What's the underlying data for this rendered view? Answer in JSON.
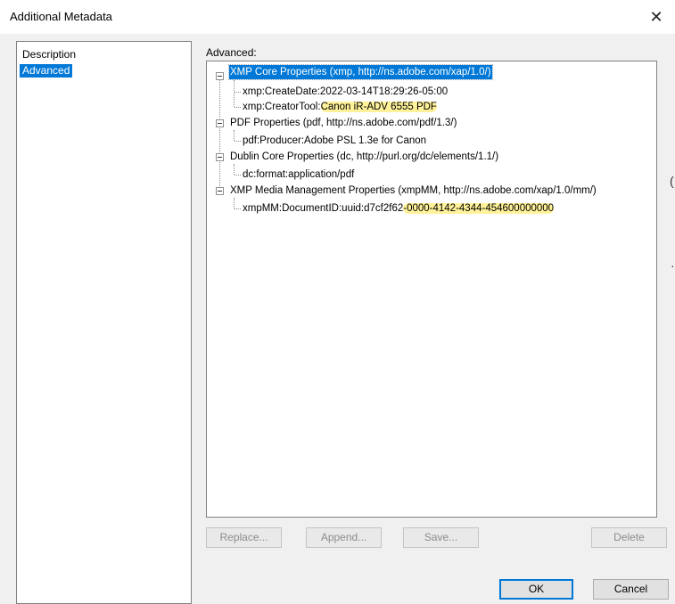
{
  "window": {
    "title": "Additional Metadata",
    "close_icon": "close-icon"
  },
  "sidebar": {
    "items": [
      {
        "label": "Description",
        "selected": false
      },
      {
        "label": "Advanced",
        "selected": true
      }
    ]
  },
  "main": {
    "label": "Advanced:",
    "tree": {
      "xmp": {
        "label": "XMP Core Properties (xmp, http://ns.adobe.com/xap/1.0/)",
        "create_date": "xmp:CreateDate:2022-03-14T18:29:26-05:00",
        "creator_tool_key": "xmp:CreatorTool:",
        "creator_tool_value": "Canon iR-ADV 6555  PDF"
      },
      "pdf": {
        "label": "PDF Properties (pdf, http://ns.adobe.com/pdf/1.3/)",
        "producer": "pdf:Producer:Adobe PSL 1.3e for Canon"
      },
      "dc": {
        "label": "Dublin Core Properties (dc, http://purl.org/dc/elements/1.1/)",
        "format": "dc:format:application/pdf"
      },
      "xmpmm": {
        "label": "XMP Media Management Properties (xmpMM, http://ns.adobe.com/xap/1.0/mm/)",
        "doc_id_key": "xmpMM:DocumentID:uuid:d7cf2f62",
        "doc_id_value": "-0000-4142-4344-454600000000"
      }
    }
  },
  "buttons": {
    "replace": "Replace...",
    "append": "Append...",
    "save": "Save...",
    "delete": "Delete",
    "ok": "OK",
    "cancel": "Cancel"
  },
  "colors": {
    "selection": "#0078d7",
    "highlight": "#fff29a"
  }
}
